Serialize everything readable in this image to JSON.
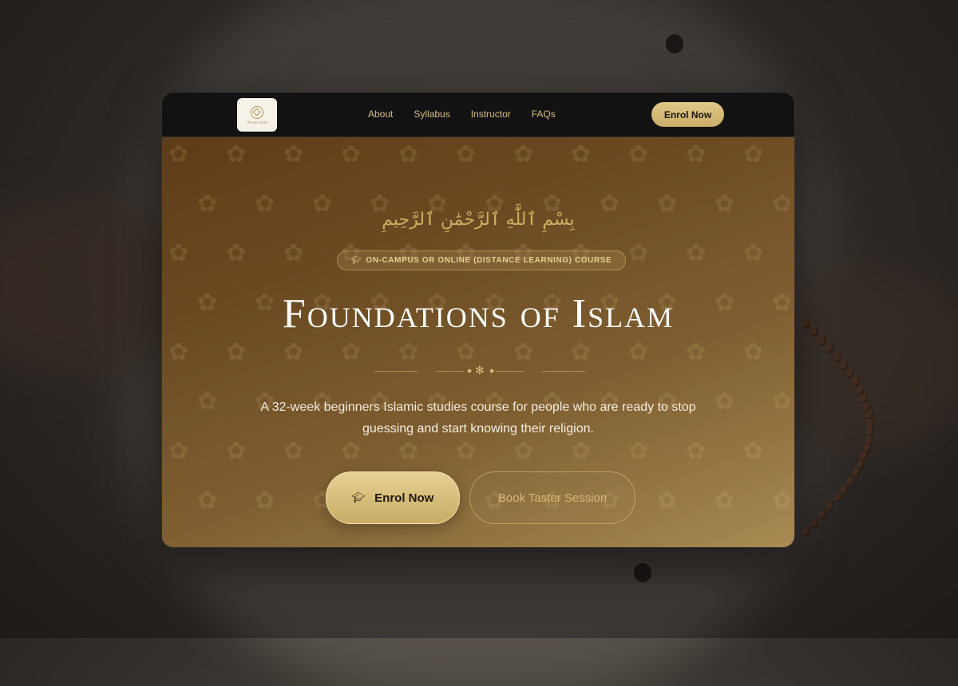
{
  "nav": {
    "logo_text": "Ihsaan Hub",
    "links": [
      "About",
      "Syllabus",
      "Instructor",
      "FAQs"
    ],
    "cta_label": "Enrol Now"
  },
  "hero": {
    "arabic": "بِسْمِ ٱللَّٰهِ ٱلرَّحْمَٰنِ ٱلرَّحِيمِ",
    "badge_text": "ON-CAMPUS OR ONLINE (DISTANCE LEARNING) COURSE",
    "badge_icon": "graduation-cap-icon",
    "title": "Foundations of Islam",
    "subtitle": "A 32-week beginners Islamic studies course for people who are ready to stop guessing and start knowing their religion.",
    "primary_button": "Enrol Now",
    "secondary_button": "Book Taster Session"
  },
  "colors": {
    "accent_gold": "#d9bd7e",
    "navbar_bg": "#121212",
    "hero_gradient_start": "#5a3815",
    "hero_gradient_end": "#a88a52"
  }
}
